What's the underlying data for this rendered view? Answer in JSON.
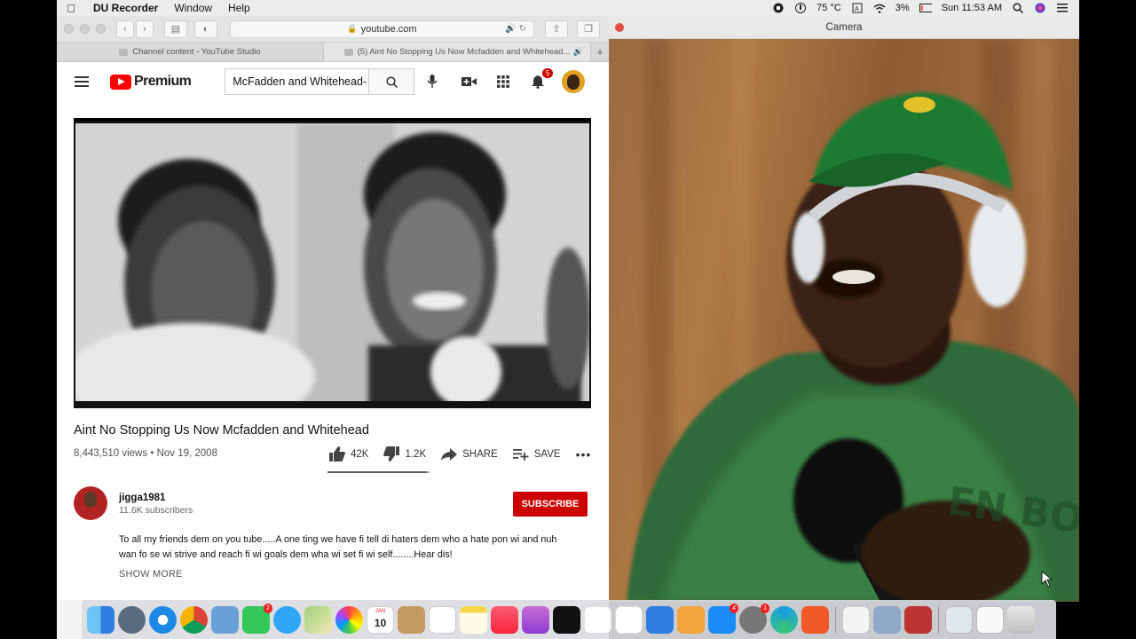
{
  "menubar": {
    "app_name": "DU Recorder",
    "items": [
      "Window",
      "Help"
    ],
    "temperature": "75 °C",
    "battery": "3%",
    "clock": "Sun 11:53 AM"
  },
  "safari": {
    "url": "youtube.com",
    "tabs": [
      {
        "label": "Channel content - YouTube Studio",
        "active": false
      },
      {
        "label": "(5) Aint No Stopping Us Now Mcfadden and Whitehead...",
        "active": true
      }
    ]
  },
  "youtube": {
    "logo_text": "Premium",
    "search_value": "McFadden and Whitehead-",
    "notification_count": "5",
    "video": {
      "title": "Aint No Stopping Us Now Mcfadden and Whitehead",
      "views": "8,443,510 views",
      "date": "Nov 19, 2008",
      "likes": "42K",
      "dislikes": "1.2K",
      "share_label": "SHARE",
      "save_label": "SAVE",
      "like_ratio": 0.97
    },
    "channel": {
      "name": "jigga1981",
      "subscribers": "11.6K subscribers",
      "subscribe_label": "SUBSCRIBE",
      "description": "To all my friends dem on you tube.....A one ting we have fi tell di haters dem who a hate pon wi and nuh wan fo se wi strive and reach fi wi goals dem wha wi set fi wi self........Hear dis!",
      "show_more": "SHOW MORE"
    }
  },
  "camera": {
    "title": "Camera"
  },
  "dock": {
    "calendar_month": "JAN",
    "calendar_day": "10",
    "badges": {
      "facetime": "2",
      "appstore": "4",
      "sysprefs": "1"
    }
  },
  "colors": {
    "youtube_red": "#ff0000",
    "subscribe_red": "#cc0000"
  }
}
